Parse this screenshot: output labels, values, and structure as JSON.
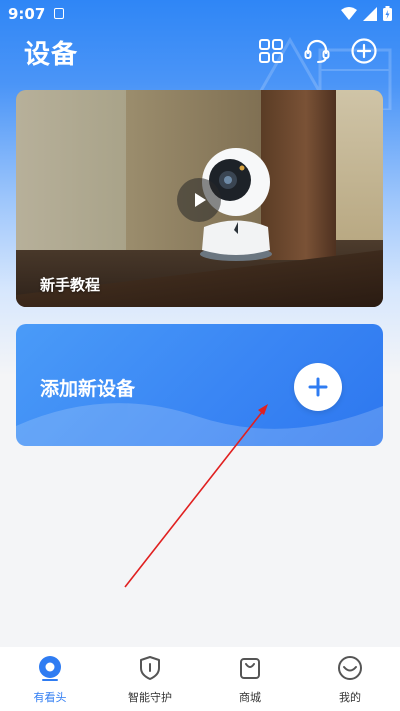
{
  "status_bar": {
    "time": "9:07"
  },
  "header": {
    "title": "设备"
  },
  "top_actions": [
    {
      "name": "grid-icon"
    },
    {
      "name": "headset-icon"
    },
    {
      "name": "add-circle-icon"
    }
  ],
  "tutorial_card": {
    "label": "新手教程"
  },
  "add_device_card": {
    "label": "添加新设备"
  },
  "bottom_nav": {
    "items": [
      {
        "label": "有看头",
        "icon": "home-eye-icon",
        "active": true
      },
      {
        "label": "智能守护",
        "icon": "shield-icon",
        "active": false
      },
      {
        "label": "商城",
        "icon": "shopping-bag-icon",
        "active": false
      },
      {
        "label": "我的",
        "icon": "profile-face-icon",
        "active": false
      }
    ]
  },
  "colors": {
    "accent": "#2f7cf2",
    "header_blue": "#2f86f6",
    "annotation_red": "#e02020"
  }
}
